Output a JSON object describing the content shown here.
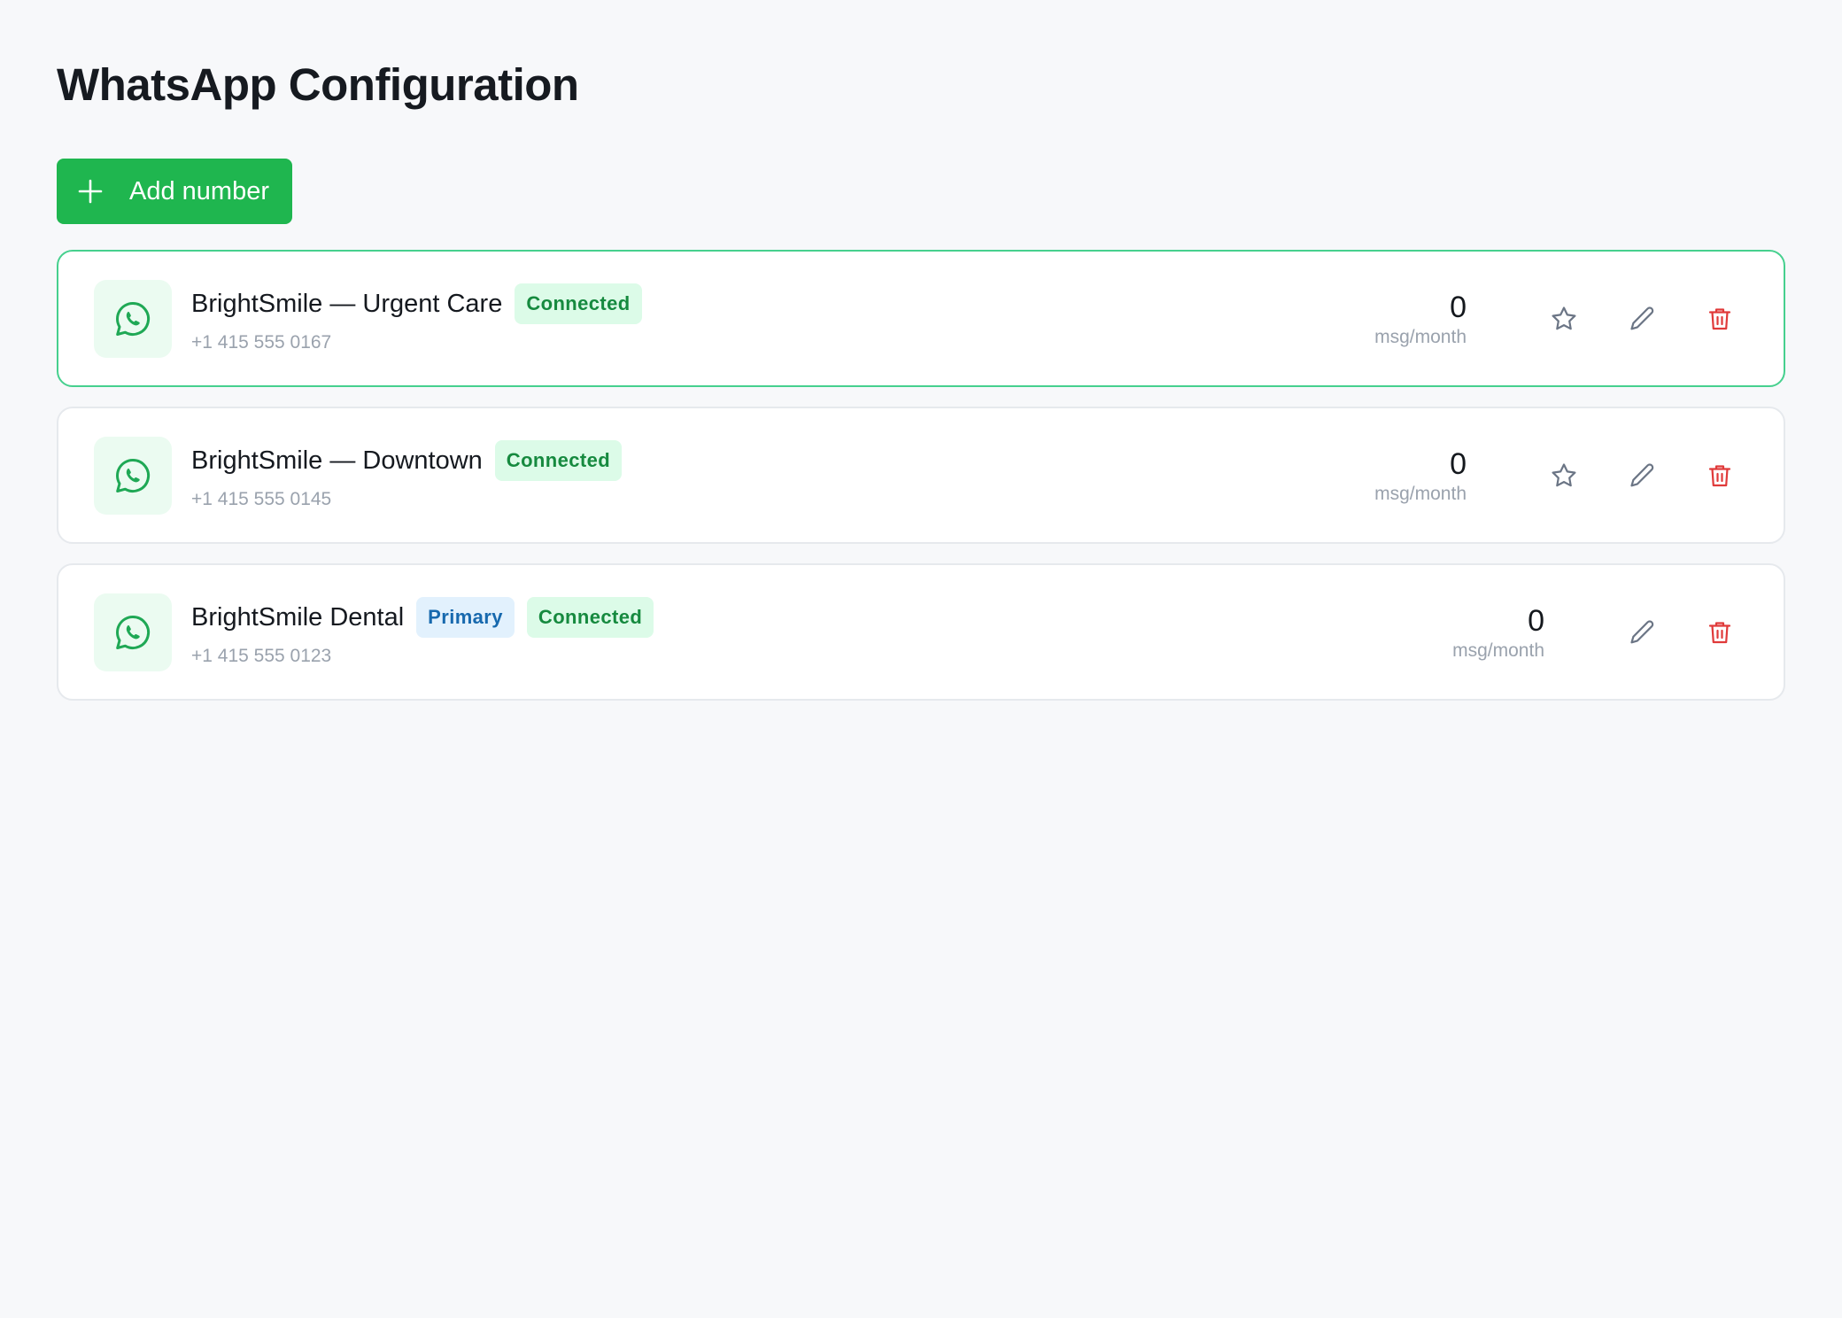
{
  "page": {
    "title": "WhatsApp Configuration",
    "add_button_label": "Add number"
  },
  "colors": {
    "accent": "#1fb64f",
    "active_border": "#46d08e",
    "connected_bg": "#dcfbe8",
    "connected_text": "#168a3f",
    "primary_bg": "#e2f1fd",
    "primary_text": "#1769ae",
    "delete_red": "#e03a3a"
  },
  "numbers": [
    {
      "name": "BrightSmile — Urgent Care",
      "phone": "+1 415 555 0167",
      "badges": [
        "Connected"
      ],
      "messages": "0",
      "unit": "msg/month",
      "active": true,
      "icons": [
        "star-icon",
        "pencil-icon",
        "trash-icon"
      ]
    },
    {
      "name": "BrightSmile — Downtown",
      "phone": "+1 415 555 0145",
      "badges": [
        "Connected"
      ],
      "messages": "0",
      "unit": "msg/month",
      "active": false,
      "icons": [
        "star-icon",
        "pencil-icon",
        "trash-icon"
      ]
    },
    {
      "name": "BrightSmile Dental",
      "phone": "+1 415 555 0123",
      "primary_badge": "Primary",
      "badges": [
        "Connected"
      ],
      "messages": "0",
      "unit": "msg/month",
      "active": false,
      "icons": [
        "pencil-icon",
        "trash-icon"
      ]
    }
  ]
}
